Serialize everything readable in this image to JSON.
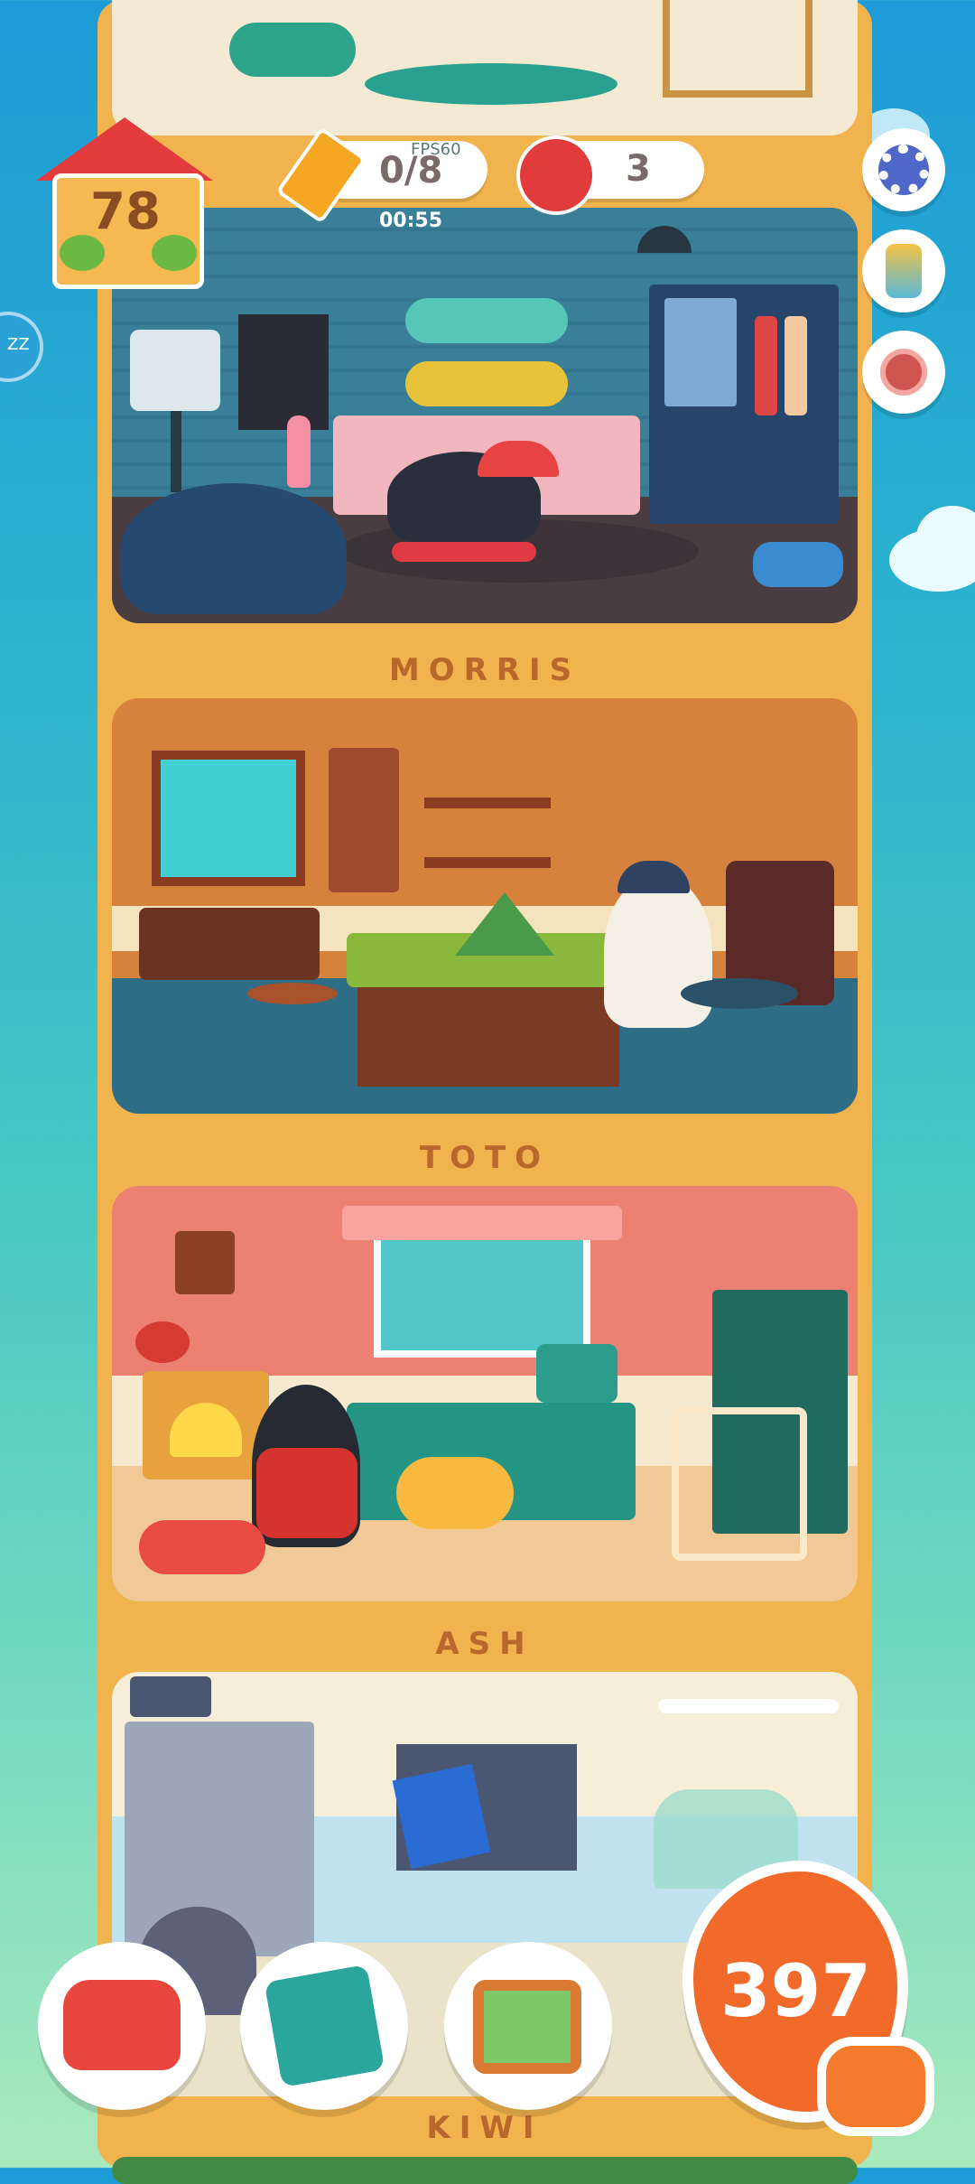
{
  "house": {
    "level": "78"
  },
  "hud": {
    "pencil_count": "0/8",
    "timer": "00:55",
    "overlay_text": "FPS60",
    "fish_can_count": "3"
  },
  "rooms": [
    {
      "name": "MORRIS"
    },
    {
      "name": "TOTO"
    },
    {
      "name": "ASH"
    },
    {
      "name": "KIWI"
    }
  ],
  "side_badge": {
    "text": "ZZ"
  },
  "currency": {
    "value": "397"
  },
  "icons": {
    "settings": "gear-icon",
    "paint": "paintbrush-icon",
    "treat": "meat-icon",
    "furniture": "armchair-icon",
    "catalog": "paw-book-icon",
    "gallery": "picture-frame-icon",
    "cat": "cat-head-icon"
  }
}
